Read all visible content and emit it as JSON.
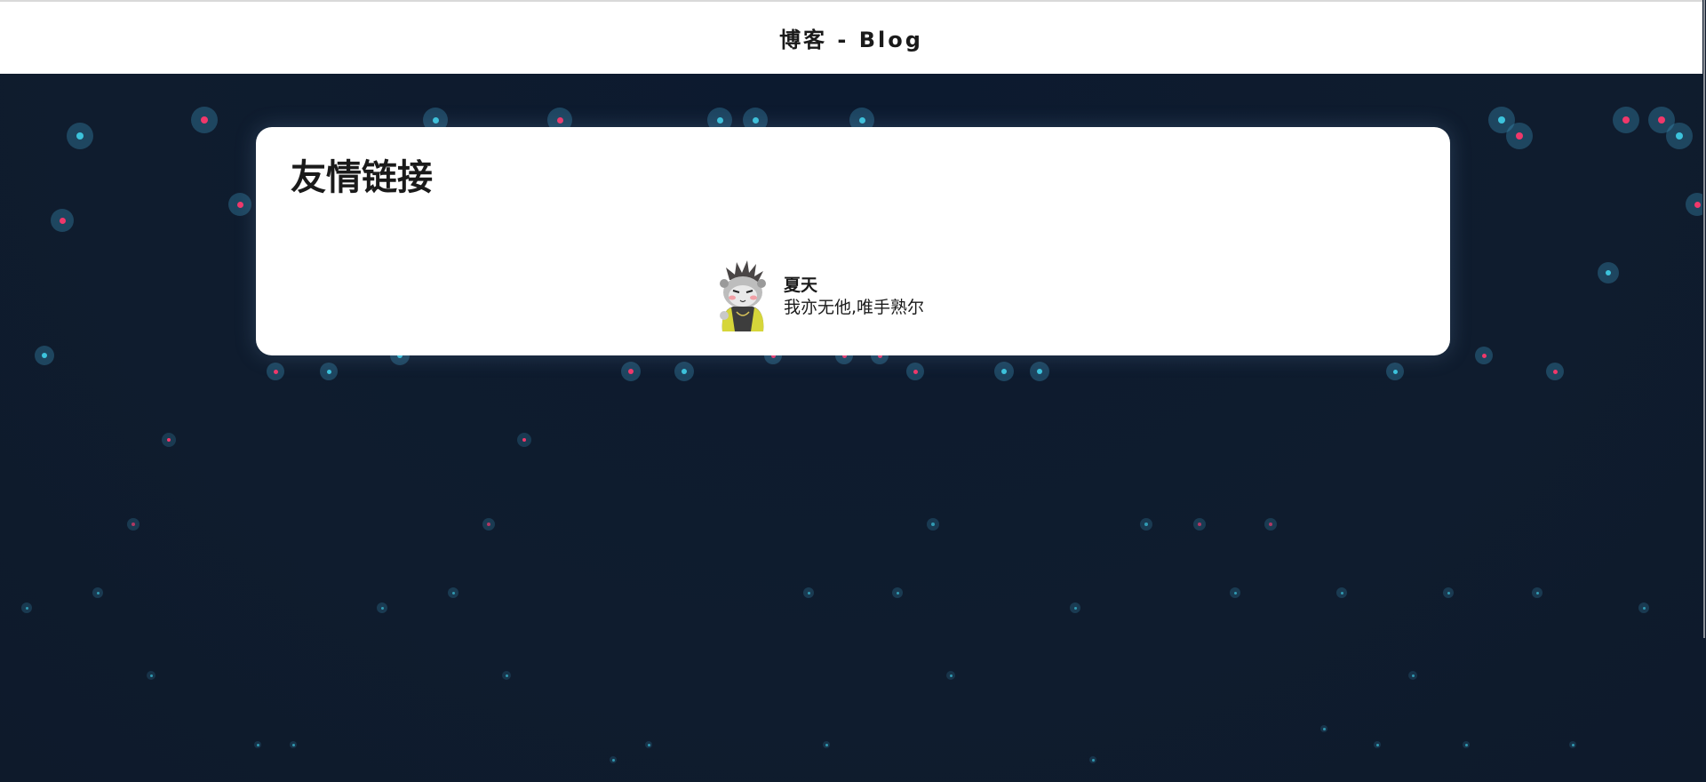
{
  "header": {
    "title": "博客 - Blog"
  },
  "page": {
    "title": "友情链接"
  },
  "friends": [
    {
      "name": "夏天",
      "description": "我亦无他,唯手熟尔",
      "avatar_icon": "hamster-avatar-icon"
    }
  ],
  "colors": {
    "background": "#0f1b2d",
    "dot_cyan": "#3cc3dc",
    "dot_pink": "#f0386b",
    "card": "#ffffff"
  }
}
